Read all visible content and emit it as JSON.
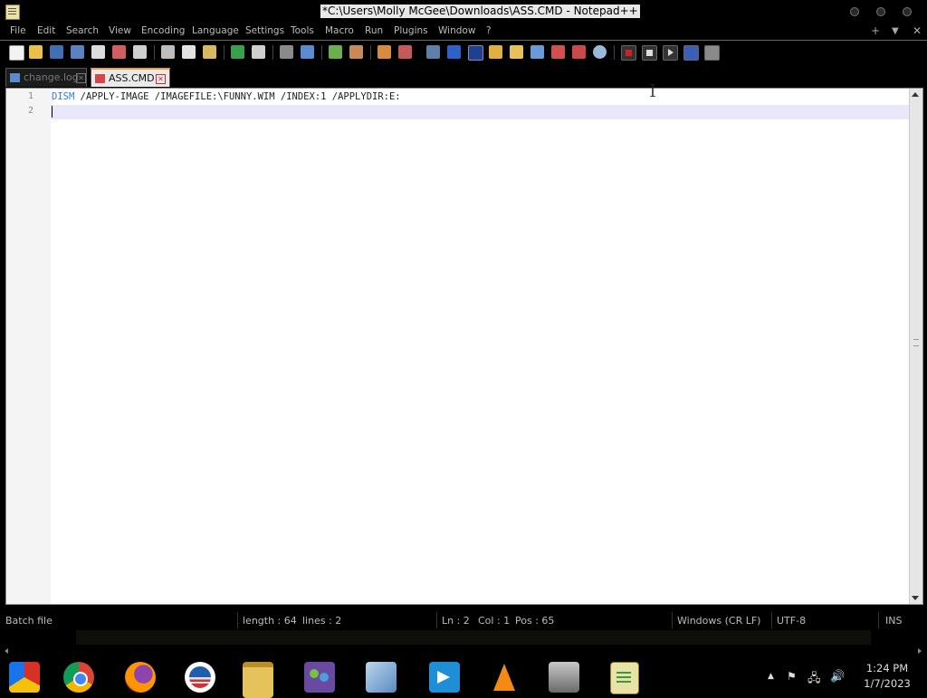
{
  "window": {
    "title": "*C:\\Users\\Molly McGee\\Downloads\\ASS.CMD - Notepad++"
  },
  "menu": {
    "items": [
      "File",
      "Edit",
      "Search",
      "View",
      "Encoding",
      "Language",
      "Settings",
      "Tools",
      "Macro",
      "Run",
      "Plugins",
      "Window",
      "?"
    ],
    "right": [
      "+",
      "▼",
      "✕"
    ]
  },
  "tabs": [
    {
      "label": "change.log",
      "active": false
    },
    {
      "label": "ASS.CMD",
      "active": true
    }
  ],
  "editor": {
    "lines": [
      {
        "number": "1",
        "keyword": "DISM",
        "rest": " /APPLY-IMAGE /IMAGEFILE:\\FUNNY.WIM /INDEX:1 /APPLYDIR:E:"
      },
      {
        "number": "2",
        "keyword": "",
        "rest": ""
      }
    ],
    "current_line": 2
  },
  "status": {
    "language": "Batch file",
    "length": "length : 64",
    "lines": "lines : 2",
    "ln": "Ln : 2",
    "col": "Col : 1",
    "pos": "Pos : 65",
    "eol": "Windows (CR LF)",
    "encoding": "UTF-8",
    "mode": "INS"
  },
  "taskbar": {
    "apps": [
      "chrome-dev-icon",
      "chrome-icon",
      "firefox-icon",
      "obama-icon",
      "file-explorer-icon",
      "people-icon",
      "notepad-icon",
      "remote-desktop-icon",
      "vlc-icon",
      "scanner-icon",
      "notepad-plus-plus-icon"
    ],
    "time": "1:24 PM",
    "date": "1/7/2023"
  },
  "colors": {
    "keyword": "#3a7ad6",
    "active_tab_accent": "#f0a030",
    "current_line": "#e8e8fa"
  }
}
